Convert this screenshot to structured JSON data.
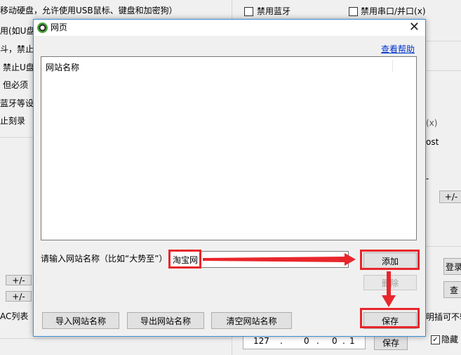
{
  "background": {
    "row1_text": "移动硬盘，允许使用USB鼠标、键盘和加密狗）",
    "disable_bluetooth": "禁用蓝牙",
    "disable_serial": "禁用串口/并口(x)",
    "row2_text": "用(如U盘",
    "row3_text": "斗，禁止",
    "row4_text": "禁止U盘",
    "row5_text": "但必须",
    "row6_text": "蓝牙等设",
    "row7_text": "止刻录",
    "partial_right1": "(x)",
    "partial_right2": "ost",
    "partial_right3": "-",
    "plus_minus": "+/-",
    "ac_list": "AC列表",
    "login_btn": "登录",
    "query_btn": "查",
    "unreadable_text": "明插可不输",
    "hide_label": "隐藏",
    "ip_parts": [
      "127",
      ".",
      "0",
      ".",
      "0",
      ".",
      "1"
    ],
    "save_btn": "保存"
  },
  "dialog": {
    "title": "网页",
    "close": "✕",
    "help_link": "查看帮助",
    "list_column": "网站名称",
    "prompt": "请输入网站名称（比如“大势至”）",
    "input_value": "淘宝网",
    "add_btn": "添加",
    "delete_btn": "删除",
    "import_btn": "导入网站名称",
    "export_btn": "导出网站名称",
    "clear_btn": "清空网站名称",
    "ok_btn": "保存"
  },
  "annotation_color": "#e8262b"
}
